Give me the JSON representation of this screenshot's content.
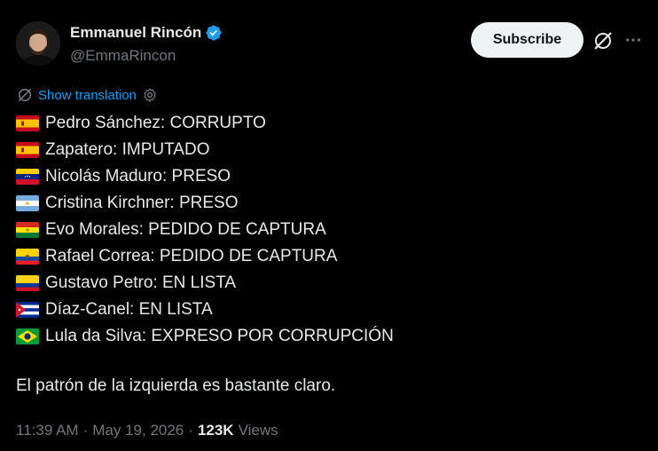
{
  "author": {
    "display_name": "Emmanuel Rincón",
    "handle": "@EmmaRincon",
    "avatar_icon": "person-photo",
    "verified_icon": "verified-badge-icon"
  },
  "header": {
    "subscribe_label": "Subscribe",
    "grok_icon": "grok-icon",
    "more_icon": "more-horizontal-icon"
  },
  "translation": {
    "label": "Show translation",
    "settings_icon": "gear-icon"
  },
  "tweet": {
    "lines": [
      {
        "flag": "spain",
        "text": "Pedro Sánchez: CORRUPTO"
      },
      {
        "flag": "spain",
        "text": "Zapatero: IMPUTADO"
      },
      {
        "flag": "venezuela",
        "text": "Nicolás Maduro: PRESO"
      },
      {
        "flag": "argentina",
        "text": "Cristina Kirchner: PRESO"
      },
      {
        "flag": "bolivia",
        "text": "Evo Morales: PEDIDO DE CAPTURA"
      },
      {
        "flag": "ecuador",
        "text": "Rafael Correa: PEDIDO DE CAPTURA"
      },
      {
        "flag": "colombia",
        "text": "Gustavo Petro: EN LISTA"
      },
      {
        "flag": "cuba",
        "text": "Díaz-Canel: EN LISTA"
      },
      {
        "flag": "brazil",
        "text": "Lula da Silva: EXPRESO POR CORRUPCIÓN"
      }
    ],
    "closing": "El patrón de la izquierda es bastante claro."
  },
  "meta": {
    "time": "11:39 AM",
    "separator": "·",
    "date": "May 19, 2026",
    "views_count": "123K",
    "views_label": "Views"
  },
  "colors": {
    "background": "#000000",
    "text": "#e7e9ea",
    "muted": "#71767b",
    "link": "#1d9bf0",
    "verified": "#1d9bf0",
    "button_bg": "#eff3f4"
  }
}
